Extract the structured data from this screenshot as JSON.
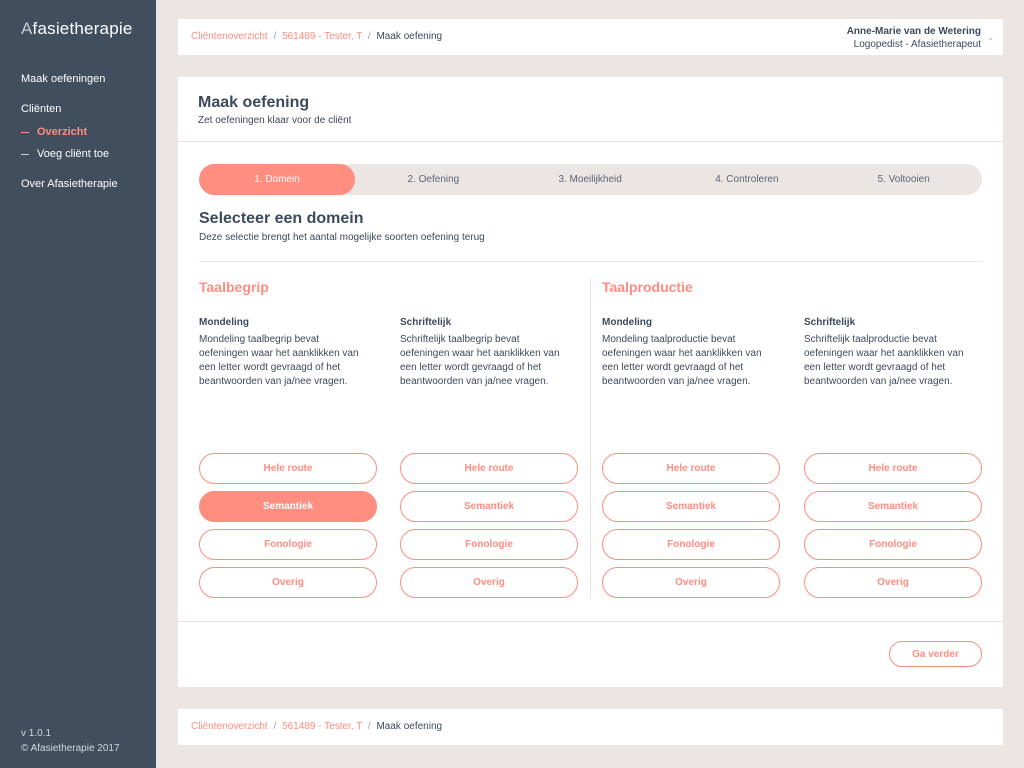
{
  "sidebar": {
    "logo_dim": "A",
    "logo_text": "fasietherapie",
    "nav_create": "Maak oefeningen",
    "nav_clients": "Cliënten",
    "nav_overview": "Overzicht",
    "nav_add_client": "Voeg cliënt toe",
    "nav_about": "Over Afasietherapie",
    "version": "v 1.0.1",
    "copyright": "© Afasietherapie 2017"
  },
  "breadcrumb": {
    "items": [
      "Cliëntenoverzicht",
      "561489 - Tester, T"
    ],
    "separator": "/",
    "current": "Maak oefening"
  },
  "user": {
    "name": "Anne-Marie van de Wetering",
    "role": "Logopedist - Afasietherapeut",
    "chevron": "⌄"
  },
  "page": {
    "title": "Maak oefening",
    "subtitle": "Zet oefeningen klaar voor de cliënt"
  },
  "steps": [
    "1. Domein",
    "2. Oefening",
    "3. Moeilijkheid",
    "4. Controleren",
    "5. Voltooien"
  ],
  "active_step": 0,
  "section": {
    "title": "Selecteer een domein",
    "subtitle": "Deze selectie brengt het aantal mogelijke soorten oefening terug"
  },
  "groups": [
    {
      "title": "Taalbegrip",
      "columns": [
        {
          "title": "Mondeling",
          "description": "Mondeling taalbegrip bevat oefeningen waar het aanklikken van een letter wordt gevraagd of het beantwoorden van ja/nee vragen."
        },
        {
          "title": "Schriftelijk",
          "description": "Schriftelijk taalbegrip bevat oefeningen waar het aanklikken van een letter wordt gevraagd of het beantwoorden van ja/nee vragen."
        }
      ]
    },
    {
      "title": "Taalproductie",
      "columns": [
        {
          "title": "Mondeling",
          "description": "Mondeling taalproductie bevat oefeningen waar het aanklikken van een letter wordt gevraagd of het beantwoorden van ja/nee vragen."
        },
        {
          "title": "Schriftelijk",
          "description": "Schriftelijk taalproductie bevat oefeningen waar het aanklikken van een letter wordt gevraagd of het beantwoorden van ja/nee vragen."
        }
      ]
    }
  ],
  "options": [
    "Hele route",
    "Semantiek",
    "Fonologie",
    "Overig"
  ],
  "selected": {
    "column": 0,
    "option": 1
  },
  "next_label": "Ga verder",
  "colors": {
    "accent": "#ff8d80",
    "sidebar": "#414e5e",
    "background": "#ebe6e4",
    "text": "#3d4a5b"
  }
}
